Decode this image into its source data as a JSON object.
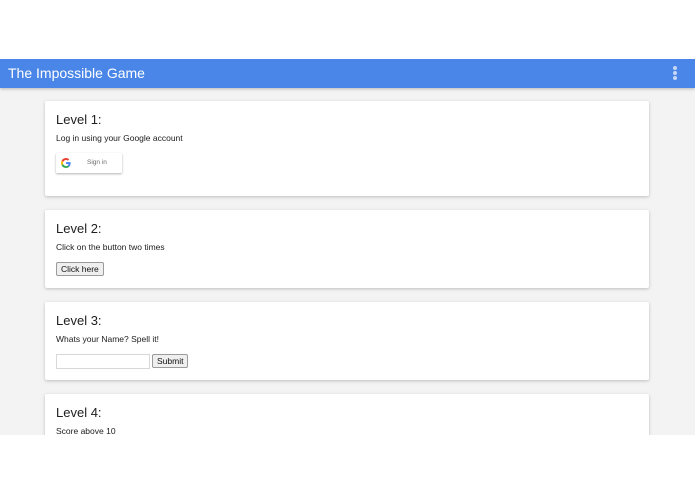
{
  "app": {
    "title": "The Impossible Game",
    "accent_color": "#4a86e8",
    "menu_icon": "more-vert-icon"
  },
  "levels": [
    {
      "title": "Level 1:",
      "instruction": "Log in using your Google account",
      "control": {
        "type": "google-signin",
        "label": "Sign in",
        "icon": "google-logo-icon"
      }
    },
    {
      "title": "Level 2:",
      "instruction": "Click on the button two times",
      "control": {
        "type": "button",
        "label": "Click here"
      }
    },
    {
      "title": "Level 3:",
      "instruction": "Whats your Name? Spell it!",
      "control": {
        "type": "input-submit",
        "input_value": "",
        "input_placeholder": "",
        "submit_label": "Submit"
      }
    },
    {
      "title": "Level 4:",
      "instruction": "Score above 10"
    }
  ]
}
